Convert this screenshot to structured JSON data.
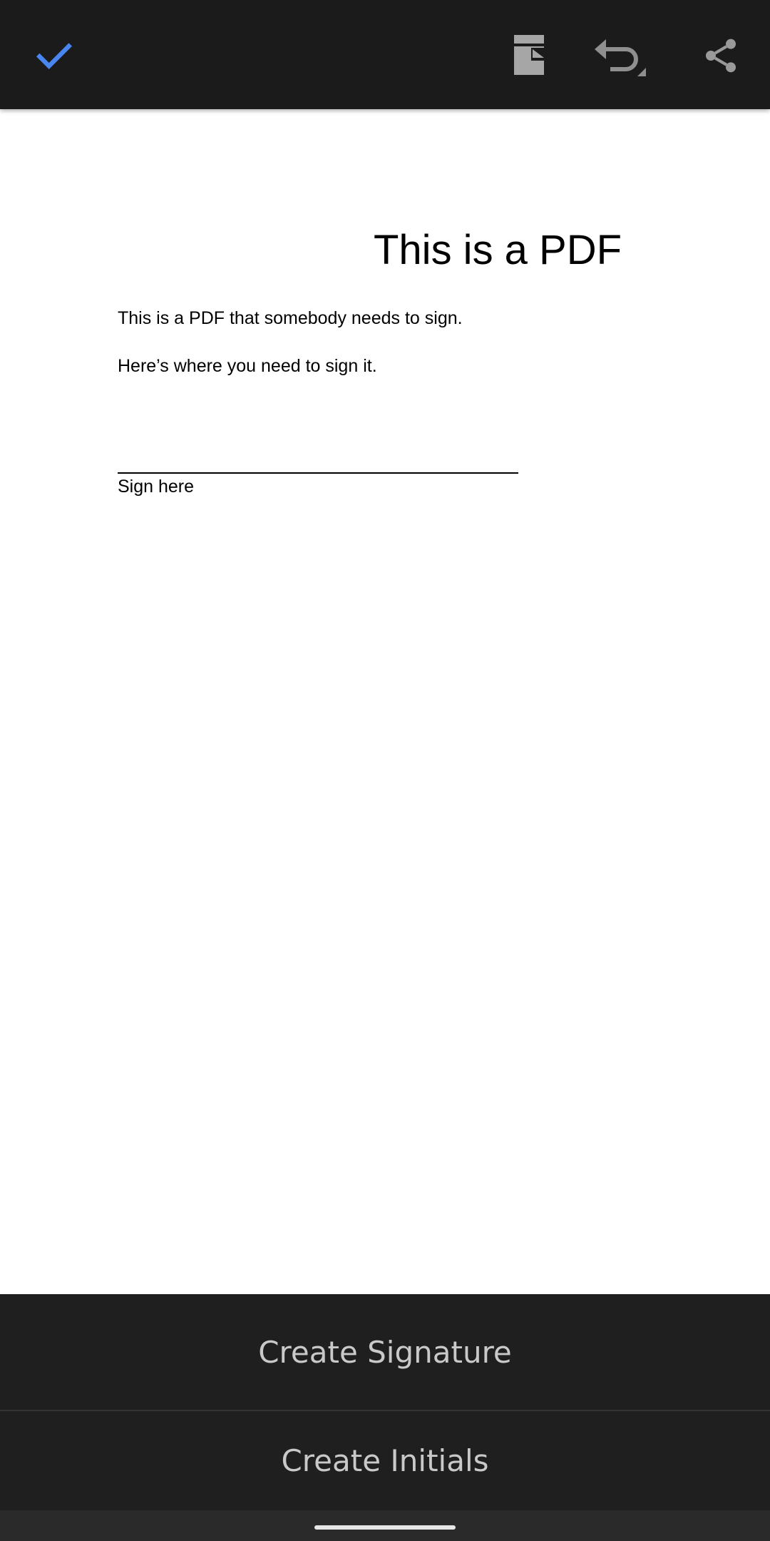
{
  "toolbar": {
    "done_icon": "check-icon",
    "page_icon": "document-page-icon",
    "undo_icon": "undo-icon",
    "share_icon": "share-icon",
    "accent_color": "#4285f4",
    "icon_color": "#a0a0a0"
  },
  "document": {
    "title": "This is a PDF",
    "paragraphs": [
      "This is a PDF that somebody needs to sign.",
      "Here’s where you need to sign it."
    ],
    "signature_label": "Sign here"
  },
  "sheet": {
    "create_signature_label": "Create Signature",
    "create_initials_label": "Create Initials"
  }
}
